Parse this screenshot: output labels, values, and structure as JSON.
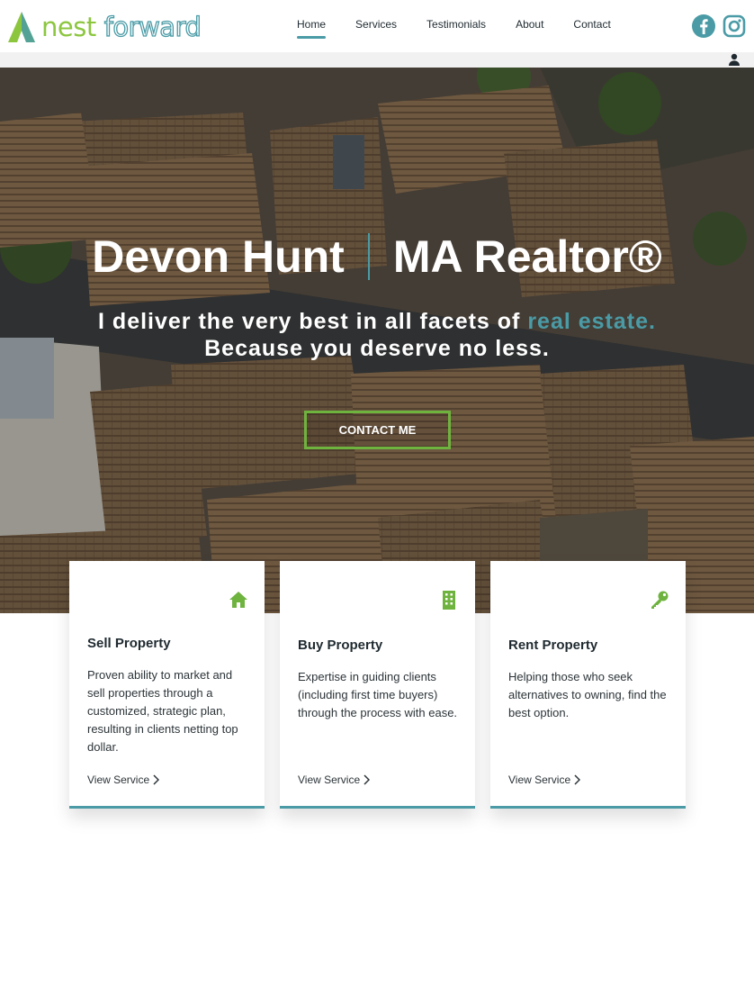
{
  "header": {
    "logo": {
      "word1": "nest",
      "word2": "forward"
    },
    "nav": [
      {
        "label": "Home",
        "active": true
      },
      {
        "label": "Services",
        "active": false
      },
      {
        "label": "Testimonials",
        "active": false
      },
      {
        "label": "About",
        "active": false
      },
      {
        "label": "Contact",
        "active": false
      }
    ],
    "social": [
      {
        "icon": "facebook-icon"
      },
      {
        "icon": "instagram-icon"
      }
    ],
    "utility_icon": "user-icon"
  },
  "hero": {
    "name": "Devon Hunt",
    "role": "MA Realtor®",
    "sub_line1_start": "I deliver the very best in all facets of ",
    "sub_line1_accent": "real estate.",
    "sub_line2": "Because you deserve no less.",
    "cta_label": "CONTACT ME",
    "background": "aerial-rooftops-photo"
  },
  "cards": [
    {
      "icon": "home-icon",
      "title": "Sell Property",
      "text": "Proven ability to market and sell properties through a customized, strategic plan, resulting in clients netting top dollar.",
      "link": "View Service"
    },
    {
      "icon": "building-icon",
      "title": "Buy Property",
      "text": "Expertise in guiding clients (including first time buyers) through the process with ease.",
      "link": "View Service"
    },
    {
      "icon": "key-icon",
      "title": "Rent Property",
      "text": "Helping those who seek alternatives to owning, find the best option.",
      "link": "View Service"
    }
  ],
  "colors": {
    "brand_green": "#8cc63f",
    "brand_teal": "#4a9ba6",
    "cta_border": "#6fb33f",
    "icon_green": "#6fb33f"
  }
}
